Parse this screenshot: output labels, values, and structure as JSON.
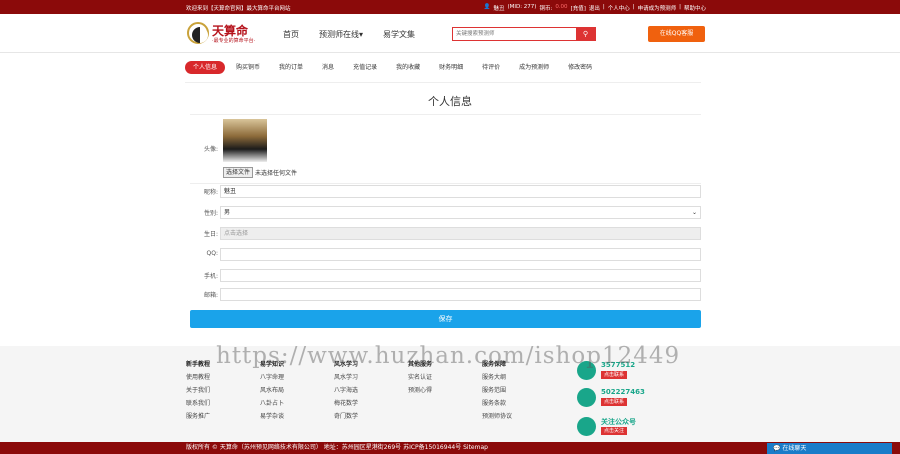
{
  "topbar": {
    "welcome": "欢迎来到【天算命官网】最大算命平台网站",
    "user": "魅丑",
    "mid": "(MID: 277)",
    "coins_label": "铜币:",
    "coins": "0.00",
    "recharge": "[充值]",
    "logout": "退出",
    "center": "个人中心",
    "apply": "申请成为预测师",
    "help": "帮助中心"
  },
  "logo": {
    "title": "天算命",
    "subtitle": "·最专业的算命平台·"
  },
  "nav": [
    "首页",
    "预测师在线",
    "易学文集"
  ],
  "search": {
    "placeholder": "关键搜索预测师",
    "button_icon": "search-icon"
  },
  "qq_button": "在线QQ客服",
  "tabs": [
    "个人信息",
    "购买铜币",
    "我的订单",
    "消息",
    "充值记录",
    "我的收藏",
    "财务明细",
    "待评价",
    "成为预测师",
    "修改密码"
  ],
  "page_title": "个人信息",
  "form": {
    "avatar_label": "头像:",
    "file_button": "选择文件",
    "file_status": "未选择任何文件",
    "nickname_label": "昵称:",
    "nickname": "魅丑",
    "gender_label": "性别:",
    "gender": "男",
    "birthday_label": "生日:",
    "birthday_placeholder": "点击选择",
    "qq_label": "QQ:",
    "phone_label": "手机:",
    "email_label": "邮箱:",
    "save": "保存"
  },
  "footer": {
    "cols": [
      {
        "title": "新手教程",
        "items": [
          "使用教程",
          "关于我们",
          "联系我们",
          "服务推广"
        ]
      },
      {
        "title": "易学知识",
        "items": [
          "八字命理",
          "风水布局",
          "八卦占卜",
          "易学杂谈"
        ]
      },
      {
        "title": "风水学习",
        "items": [
          "风水学习",
          "八字海选",
          "梅花数学",
          "奇门数学"
        ]
      },
      {
        "title": "其他服务",
        "items": [
          "实名认证",
          "预测心得"
        ]
      },
      {
        "title": "服务保障",
        "items": [
          "服务大纲",
          "服务范围",
          "服务条款",
          "预测师协议"
        ]
      }
    ],
    "contacts": [
      {
        "num": "3577512",
        "tag": "点击联系"
      },
      {
        "num": "502227463",
        "tag": "点击联系"
      },
      {
        "num": "关注公众号",
        "tag": "点击关注"
      }
    ],
    "copyright": "版权所有 © 天算命（苏州预见网络技术有限公司） 地址：苏州园区星港街269号 苏ICP备15016944号 Sitemap",
    "chat": "在线聊天"
  },
  "watermark": "https://www.huzhan.com/ishop12449"
}
